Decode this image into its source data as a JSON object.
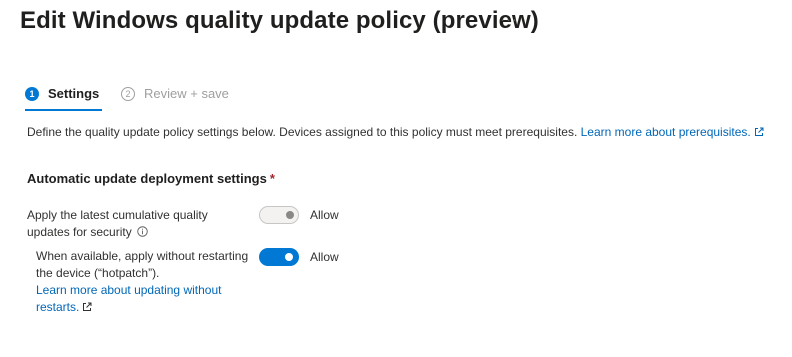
{
  "header": {
    "title": "Edit Windows quality update policy (preview)",
    "more_label": "···"
  },
  "steps": [
    {
      "number": "1",
      "label": "Settings",
      "active": true
    },
    {
      "number": "2",
      "label": "Review + save",
      "active": false
    }
  ],
  "description": {
    "text": "Define the quality update policy settings below. Devices assigned to this policy must meet prerequisites. ",
    "link_text": "Learn more about prerequisites."
  },
  "section": {
    "title": "Automatic update deployment settings",
    "required_marker": "*"
  },
  "settings": [
    {
      "label": "Apply the latest cumulative quality updates for security",
      "info_icon": "info-icon",
      "toggle_text": "Allow",
      "state": "on-disabled"
    },
    {
      "label": "When available, apply without restarting the device (“hotpatch”).",
      "link_text": "Learn more about updating without restarts.",
      "toggle_text": "Allow",
      "state": "on"
    }
  ],
  "colors": {
    "accent": "#0078d4",
    "link": "#0067b8",
    "required": "#a4262c",
    "disabled_toggle_bg": "#f3f2f1"
  }
}
